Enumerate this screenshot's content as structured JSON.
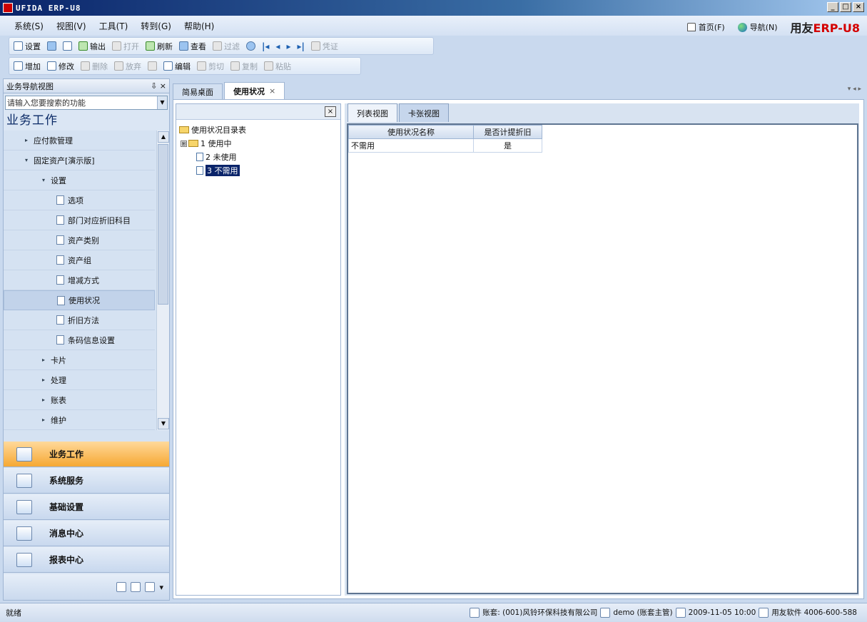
{
  "window": {
    "title": "UFIDA ERP-U8",
    "controls": [
      "_",
      "□",
      "×"
    ]
  },
  "menu": {
    "items": [
      "系统(S)",
      "视图(V)",
      "工具(T)",
      "转到(G)",
      "帮助(H)"
    ],
    "home": "首页(F)",
    "navigate": "导航(N)",
    "brand_prefix": "用友",
    "brand_erp": "ERP",
    "brand_suffix": "-U8"
  },
  "toolbar1": {
    "buttons": [
      "设置",
      "输出",
      "打开",
      "刷新",
      "查看",
      "过滤",
      "凭证"
    ]
  },
  "toolbar2": {
    "buttons": [
      "增加",
      "修改",
      "删除",
      "放弃",
      "编辑",
      "剪切",
      "复制",
      "粘贴"
    ]
  },
  "nav_panel": {
    "header": "业务导航视图",
    "pin": "⇩ ×",
    "search_placeholder": "请输入您要搜索的功能",
    "title": "业务工作",
    "items": [
      {
        "label": "应付款管理"
      },
      {
        "label": "固定资产[演示版]"
      },
      {
        "label": "设置"
      },
      {
        "label": "选项"
      },
      {
        "label": "部门对应折旧科目"
      },
      {
        "label": "资产类别"
      },
      {
        "label": "资产组"
      },
      {
        "label": "增减方式"
      },
      {
        "label": "使用状况"
      },
      {
        "label": "折旧方法"
      },
      {
        "label": "条码信息设置"
      },
      {
        "label": "卡片"
      },
      {
        "label": "处理"
      },
      {
        "label": "账表"
      },
      {
        "label": "维护"
      }
    ],
    "modules": [
      "业务工作",
      "系统服务",
      "基础设置",
      "消息中心",
      "报表中心"
    ]
  },
  "doc_tabs": {
    "tabs": [
      "简易桌面",
      "使用状况"
    ],
    "close": "×",
    "scroll": "▾ ◂ ▸"
  },
  "tree": {
    "close": "×",
    "root": "使用状况目录表",
    "nodes": [
      "1 使用中",
      "2 未使用",
      "3 不需用"
    ],
    "expander": "⊞"
  },
  "view_tabs": [
    "列表视图",
    "卡张视图"
  ],
  "grid": {
    "columns": [
      "使用状况名称",
      "是否计提折旧"
    ],
    "rows": [
      [
        "不需用",
        "是"
      ]
    ]
  },
  "status": {
    "left": "就绪",
    "account": "账套: (001)风铃环保科技有限公司",
    "user": "demo (账套主管)",
    "date": "2009-11-05 10:00",
    "vendor": "用友软件 4006-600-588"
  }
}
